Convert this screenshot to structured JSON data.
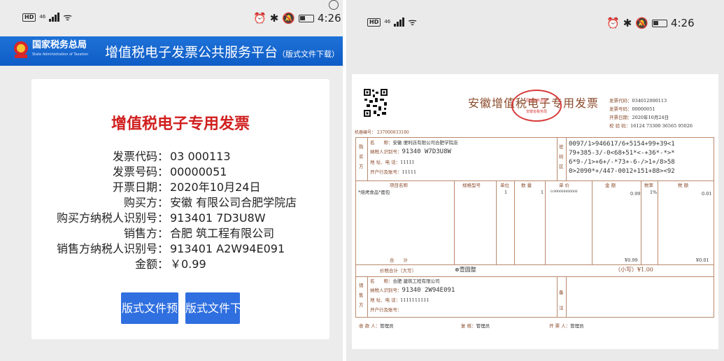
{
  "status_bar": {
    "hd": "HD",
    "net": "46",
    "time": "4:26"
  },
  "header": {
    "logo_text": "国家税务总局",
    "logo_sub": "State Administration of Taxation",
    "platform_title": "增值税电子发票公共服务平台",
    "platform_sub": "（版式文件下载）"
  },
  "invoice_card": {
    "title": "增值税电子专用发票",
    "fields": [
      {
        "label": "发票代码：",
        "value": "03   000113"
      },
      {
        "label": "发票号码：",
        "value": "00000051"
      },
      {
        "label": "开票日期：",
        "value": "2020年10月24日"
      },
      {
        "label": "购买方：",
        "value": "安徽    有限公司合肥学院店"
      },
      {
        "label": "购买方纳税人识别号：",
        "value": "913401    7D3U8W"
      },
      {
        "label": "销售方：",
        "value": "合肥    筑工程有限公司"
      },
      {
        "label": "销售方纳税人识别号：",
        "value": "913401    A2W94E091"
      },
      {
        "label": "金额：",
        "value": "￥0.99"
      }
    ],
    "buttons": [
      {
        "label": "版式文件预"
      },
      {
        "label": "版式文件下"
      }
    ]
  },
  "invoice_doc": {
    "title": "安徽增值税电子专用发票",
    "seal_top": "国家税务总局",
    "seal_bottom": "安徽省税务局",
    "meta": [
      {
        "label": "发票代码：",
        "value": "034012000113"
      },
      {
        "label": "发票号码：",
        "value": "00000051"
      },
      {
        "label": "开票日期：",
        "value": "2020年10月24日"
      },
      {
        "label": "校 验 码：",
        "value": "16124 73300 36565 95026"
      }
    ],
    "machine_no": "机器编号： 237000833180",
    "buyer": {
      "side": "购买方",
      "name_label": "名　　称：",
      "name": "安徽    便利店有限公司合肥学院店",
      "taxid_label": "纳税人识别号：",
      "taxid": "91340    W7D3U8W",
      "addr_label": "地 址、电 话：",
      "addr": "11111",
      "bank_label": "开户行及账号：",
      "bank": "11111"
    },
    "cipher_side": "密码区",
    "cipher": [
      "0097/1>946617/6+5154+99+39<1",
      "79+385-3/-0<68+51*<-+36*-*>*",
      "6*9-/1>+6+/-*73+-6-/>1+/8>58",
      "0>2090*+/447-0012+151+88><92"
    ],
    "columns": [
      "项目名称",
      "规格型号",
      "单位",
      "数 量",
      "单 价",
      "金 额",
      "税率",
      "税 额"
    ],
    "item": {
      "name": "*焙烤食品*面包",
      "unit": "1",
      "qty": "1",
      "price": "0.990000000000",
      "amount": "0.99",
      "rate": "1%",
      "tax": "0.01"
    },
    "sum_label": "合　　计",
    "sum_amount": "¥0.99",
    "sum_tax": "¥0.01",
    "total_label": "价税合计（大写）",
    "total_big": "⊗壹圆整",
    "total_small": "（小写）¥1.00",
    "seller": {
      "side": "销售方",
      "name_label": "名　　称：",
      "name": "合肥    建筑工程有限公司",
      "taxid_label": "纳税人识别号：",
      "taxid": "91340    2W94E091",
      "addr_label": "地 址、电 话：",
      "addr": "1111111111",
      "bank_label": "开户行及账号：",
      "bank": ""
    },
    "remark_side": "备注",
    "footer": [
      {
        "label": "收 款 人：",
        "value": "管理员"
      },
      {
        "label": "复 核：",
        "value": "管理员"
      },
      {
        "label": "开 票 人：",
        "value": "管理员"
      }
    ]
  },
  "colors": {
    "accent_blue": "#1e72d8",
    "title_red": "#d0201f",
    "invoice_brown": "#8a4a2a",
    "button_blue": "#2f6fe0"
  }
}
